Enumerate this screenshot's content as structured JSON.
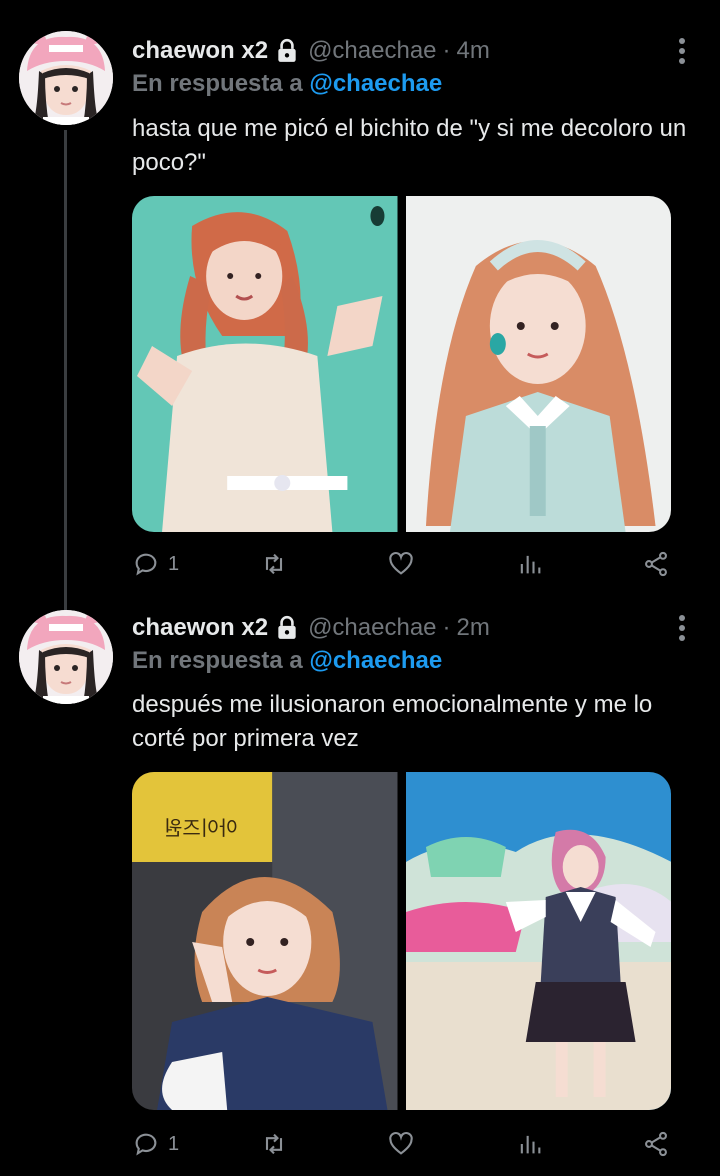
{
  "tweets": [
    {
      "display_name": "chaewon x2",
      "handle": "@chaechae",
      "separator": "·",
      "time": "4m",
      "reply_prefix": "En respuesta a",
      "reply_to": "@chaechae",
      "text": "hasta que me picó el bichito de \"y si me decoloro un poco?\"",
      "reply_count": "1",
      "icons": [
        "lock-icon",
        "more-icon",
        "reply-icon",
        "retweet-icon",
        "like-icon",
        "views-icon",
        "share-icon"
      ]
    },
    {
      "display_name": "chaewon x2",
      "handle": "@chaechae",
      "separator": "·",
      "time": "2m",
      "reply_prefix": "En respuesta a",
      "reply_to": "@chaechae",
      "text": "después me ilusionaron emocionalmente y me lo corté por primera vez",
      "reply_count": "1",
      "sign_text": "아이즈원",
      "icons": [
        "lock-icon",
        "more-icon",
        "reply-icon",
        "retweet-icon",
        "like-icon",
        "views-icon",
        "share-icon"
      ]
    }
  ],
  "colors": {
    "background": "#000000",
    "text": "#e7e9ea",
    "secondary": "#71767b",
    "accent": "#1d9bf0",
    "thread_line": "#3a3d40"
  }
}
